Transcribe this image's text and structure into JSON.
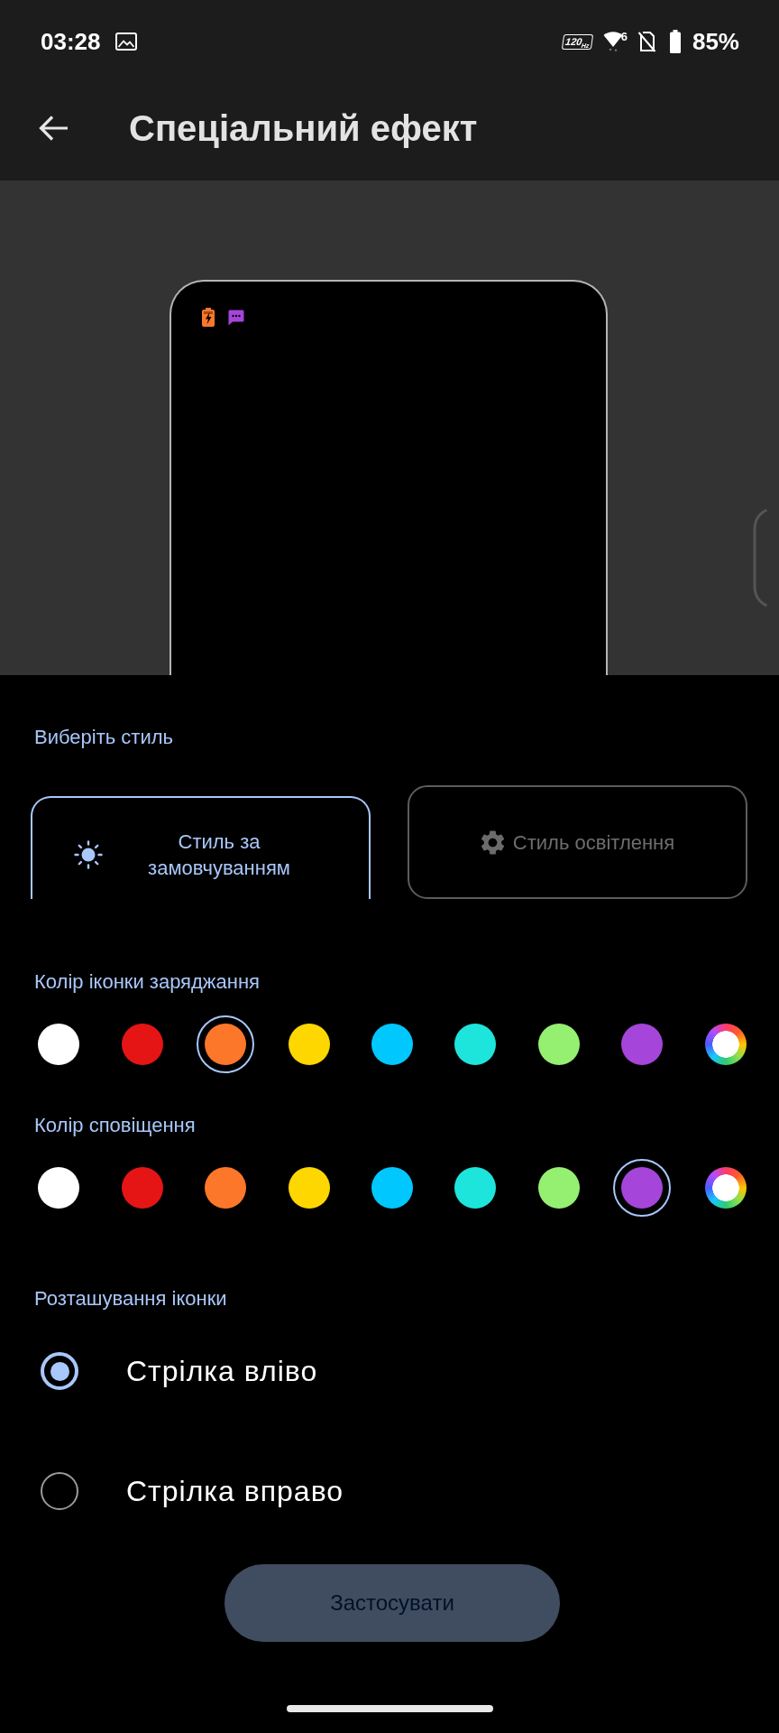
{
  "status_bar": {
    "time": "03:28",
    "refresh_rate": "120$_{Hz}$",
    "wifi_generation": "6",
    "battery": "85%"
  },
  "app_bar": {
    "title": "Спеціальний ефект"
  },
  "style": {
    "label": "Виберіть стиль",
    "options": [
      {
        "kind": "default",
        "label": "Стиль за замовчуванням",
        "selected": true
      },
      {
        "kind": "lighting",
        "label": "Стиль освітлення",
        "selected": false
      }
    ]
  },
  "charge_color": {
    "label": "Колір іконки заряджання",
    "swatches": [
      {
        "kind": "solid",
        "color": "#ffffff",
        "selected": false
      },
      {
        "kind": "solid",
        "color": "#e51515",
        "selected": false
      },
      {
        "kind": "solid",
        "color": "#fd772a",
        "selected": true
      },
      {
        "kind": "solid",
        "color": "#fed700",
        "selected": false
      },
      {
        "kind": "solid",
        "color": "#00c8fe",
        "selected": false
      },
      {
        "kind": "solid",
        "color": "#1de5dc",
        "selected": false
      },
      {
        "kind": "solid",
        "color": "#95ef70",
        "selected": false
      },
      {
        "kind": "solid",
        "color": "#a545d9",
        "selected": false
      },
      {
        "kind": "rainbow",
        "selected": false
      }
    ]
  },
  "notification_color": {
    "label": "Колір сповіщення",
    "swatches": [
      {
        "kind": "solid",
        "color": "#ffffff",
        "selected": false
      },
      {
        "kind": "solid",
        "color": "#e51515",
        "selected": false
      },
      {
        "kind": "solid",
        "color": "#fd772a",
        "selected": false
      },
      {
        "kind": "solid",
        "color": "#fed700",
        "selected": false
      },
      {
        "kind": "solid",
        "color": "#00c8fe",
        "selected": false
      },
      {
        "kind": "solid",
        "color": "#1de5dc",
        "selected": false
      },
      {
        "kind": "solid",
        "color": "#95ef70",
        "selected": false
      },
      {
        "kind": "solid",
        "color": "#a545d9",
        "selected": true
      },
      {
        "kind": "rainbow",
        "selected": false
      }
    ]
  },
  "icon_position": {
    "label": "Розташування іконки",
    "options": [
      {
        "label": "Стрілка вліво",
        "selected": true
      },
      {
        "label": "Стрілка вправо",
        "selected": false
      }
    ]
  },
  "apply_button": {
    "label": "Застосувати",
    "disabled": true
  }
}
